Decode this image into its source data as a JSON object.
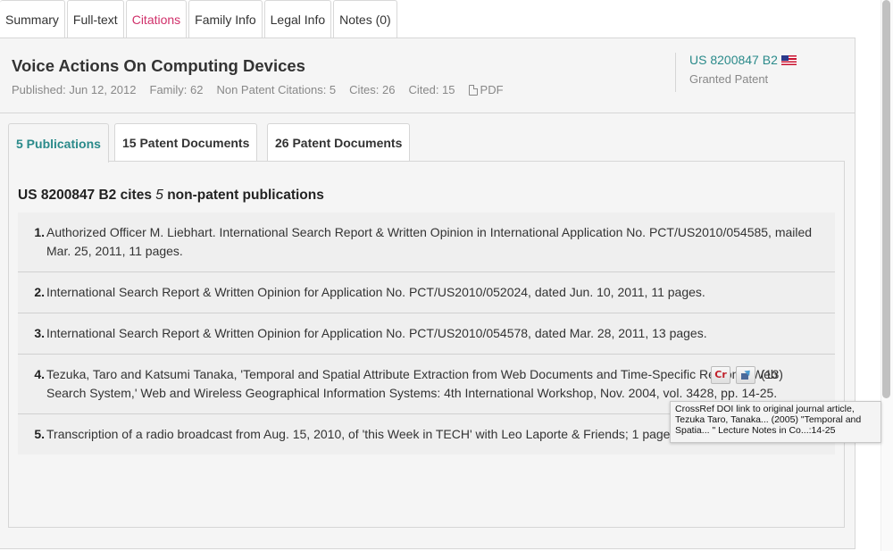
{
  "top_tabs": [
    {
      "label": "Summary"
    },
    {
      "label": "Full-text"
    },
    {
      "label": "Citations"
    },
    {
      "label": "Family Info"
    },
    {
      "label": "Legal Info"
    },
    {
      "label": "Notes (0)"
    }
  ],
  "patent": {
    "title": "Voice Actions On Computing Devices",
    "published": "Published: Jun 12, 2012",
    "family": "Family: 62",
    "non_patent_citations": "Non Patent Citations: 5",
    "cites": "Cites: 26",
    "cited": "Cited: 15",
    "pdf_label": "PDF",
    "number": "US 8200847 B2",
    "status": "Granted Patent"
  },
  "inner_tabs": [
    {
      "label": "5 Publications"
    },
    {
      "label": "15 Patent Documents"
    },
    {
      "label": "26 Patent Documents"
    }
  ],
  "content": {
    "title_prefix": "US 8200847 B2 cites",
    "title_count": "5",
    "title_suffix": "non-patent publications"
  },
  "citations": [
    {
      "num": "1.",
      "text": "Authorized Officer M. Liebhart. International Search Report & Written Opinion in International Application No. PCT/US2010/054585, mailed Mar. 25, 2011, 11 pages."
    },
    {
      "num": "2.",
      "text": "International Search Report & Written Opinion for Application No. PCT/US2010/052024, dated Jun. 10, 2011, 11 pages."
    },
    {
      "num": "3.",
      "text": "International Search Report & Written Opinion for Application No. PCT/US2010/054578, dated Mar. 28, 2011, 13 pages."
    },
    {
      "num": "4.",
      "text": "Tezuka, Taro and Katsumi Tanaka, 'Temporal and Spatial Attribute Extraction from Web Documents and Time-Specific Regional Web Search System,' Web and Wireless Geographical Information Systems: 4th International Workshop, Nov. 2004, vol. 3428, pp. 14-25."
    },
    {
      "num": "5.",
      "text": "Transcription of a radio broadcast from Aug. 15, 2010, of 'this Week in TECH' with Leo Laporte & Friends; 1 page."
    }
  ],
  "badges": {
    "crossref_glyph": "Cr",
    "count": "(13)"
  },
  "tooltip": {
    "text": "CrossRef DOI link to original journal article, Tezuka Taro, Tanaka... (2005) \"Temporal and Spatia... \" Lecture Notes in Co...:14-25"
  }
}
